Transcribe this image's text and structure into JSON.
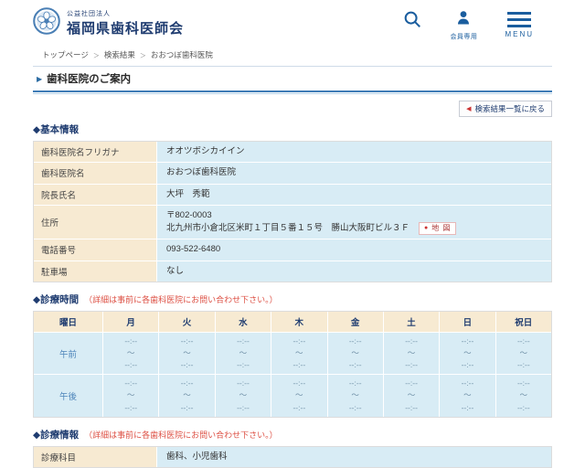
{
  "header": {
    "org_type": "公益社団法人",
    "org_name": "福岡県歯科医師会",
    "member_label": "会員専用",
    "menu_label": "MENU"
  },
  "breadcrumb": {
    "items": [
      "トップページ",
      "検索結果",
      "おおつぼ歯科医院"
    ],
    "separator": "＞"
  },
  "page": {
    "title": "歯科医院のご案内",
    "back_button": "検索結果一覧に戻る"
  },
  "icons": {
    "title_arrow": "▶",
    "back_arrow": "◀",
    "map_pin": "●"
  },
  "sections": {
    "basic_info": {
      "heading": "◆基本情報",
      "rows": [
        {
          "label": "歯科医院名フリガナ",
          "lines": [
            "オオツボシカイイン"
          ]
        },
        {
          "label": "歯科医院名",
          "lines": [
            "おおつぼ歯科医院"
          ]
        },
        {
          "label": "院長氏名",
          "lines": [
            "大坪　秀範"
          ]
        },
        {
          "label": "住所",
          "lines": [
            "〒802-0003",
            "北九州市小倉北区米町１丁目５番１５号　勝山大阪町ビル３Ｆ"
          ],
          "map_button": {
            "label": "地 図"
          }
        },
        {
          "label": "電話番号",
          "lines": [
            "093-522-6480"
          ]
        },
        {
          "label": "駐車場",
          "lines": [
            "なし"
          ]
        }
      ]
    },
    "hours": {
      "heading": "◆診療時間",
      "note": "（詳細は事前に各歯科医院にお問い合わせ下さい。）",
      "table": {
        "day_header": "曜日",
        "days": [
          "月",
          "火",
          "水",
          "木",
          "金",
          "土",
          "日",
          "祝日"
        ],
        "rows": [
          {
            "label": "午前",
            "start": "--:--",
            "separator": "～",
            "end": "--:--"
          },
          {
            "label": "午後",
            "start": "--:--",
            "separator": "～",
            "end": "--:--"
          }
        ]
      }
    },
    "clinic_info": {
      "heading": "◆診療情報",
      "note": "（詳細は事前に各歯科医院にお問い合わせ下さい。）",
      "rows": [
        {
          "label": "診療科目",
          "lines": [
            "歯科、小児歯科"
          ]
        }
      ]
    }
  },
  "colors": {
    "navy": "#1f3c70",
    "icon_blue": "#1a5d9e",
    "label_beige": "#f7ead2",
    "value_light_blue": "#d8ecf5",
    "note_red": "#dd5044",
    "rule_blue": "#3f7cb6"
  }
}
